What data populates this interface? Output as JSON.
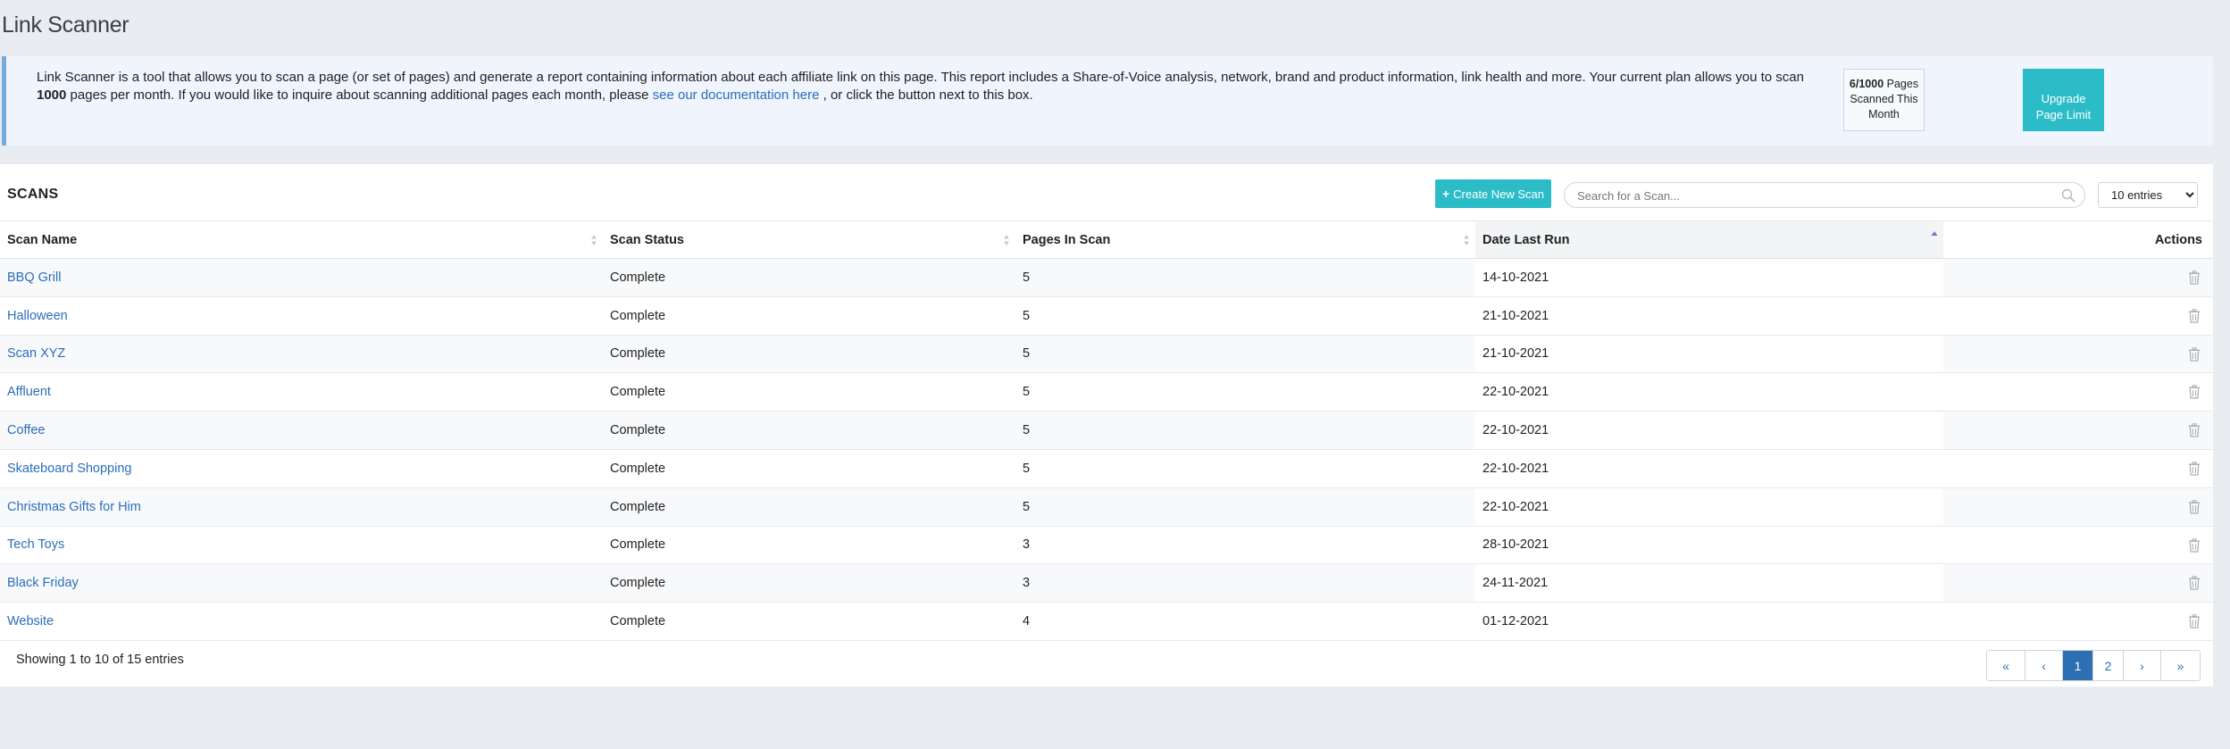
{
  "page": {
    "title": "Link Scanner"
  },
  "info": {
    "text_part1": "Link Scanner is a tool that allows you to scan a page (or set of pages) and generate a report containing information about each affiliate link on this page. This report includes a Share-of-Voice analysis, network, brand and product information, link health and more. Your current plan allows you to scan ",
    "limit_bold": "1000",
    "text_part2": " pages per month. If you would like to inquire about scanning additional pages each month, please ",
    "doc_link": "see our documentation here",
    "text_part3": " , or click the button next to this box.",
    "usage_bold": "6/1000",
    "usage_rest": " Pages Scanned This Month",
    "upgrade_label": "Upgrade Page Limit"
  },
  "scans": {
    "title": "SCANS",
    "create_label": "Create New Scan",
    "search_placeholder": "Search for a Scan...",
    "entries_selected": "10 entries",
    "columns": [
      "Scan Name",
      "Scan Status",
      "Pages In Scan",
      "Date Last Run",
      "Actions"
    ],
    "rows": [
      {
        "name": "BBQ Grill",
        "status": "Complete",
        "pages": "5",
        "date": "14-10-2021"
      },
      {
        "name": "Halloween",
        "status": "Complete",
        "pages": "5",
        "date": "21-10-2021"
      },
      {
        "name": "Scan XYZ",
        "status": "Complete",
        "pages": "5",
        "date": "21-10-2021"
      },
      {
        "name": "Affluent",
        "status": "Complete",
        "pages": "5",
        "date": "22-10-2021"
      },
      {
        "name": "Coffee",
        "status": "Complete",
        "pages": "5",
        "date": "22-10-2021"
      },
      {
        "name": "Skateboard Shopping",
        "status": "Complete",
        "pages": "5",
        "date": "22-10-2021"
      },
      {
        "name": "Christmas Gifts for Him",
        "status": "Complete",
        "pages": "5",
        "date": "22-10-2021"
      },
      {
        "name": "Tech Toys",
        "status": "Complete",
        "pages": "3",
        "date": "28-10-2021"
      },
      {
        "name": "Black Friday",
        "status": "Complete",
        "pages": "3",
        "date": "24-11-2021"
      },
      {
        "name": "Website",
        "status": "Complete",
        "pages": "4",
        "date": "01-12-2021"
      }
    ],
    "footer": "Showing 1 to 10 of 15 entries",
    "pager": {
      "first": "«",
      "prev": "‹",
      "page1": "1",
      "page2": "2",
      "next": "›",
      "last": "»"
    }
  },
  "colors": {
    "accent": "#2cbcc8",
    "link": "#2a6ebb",
    "active_page": "#2c6fb3",
    "info_border": "#7aa9dc"
  },
  "icons": {
    "search": "search-icon",
    "trash": "trash-icon",
    "sort": "sort-icon",
    "plus": "plus-icon"
  }
}
